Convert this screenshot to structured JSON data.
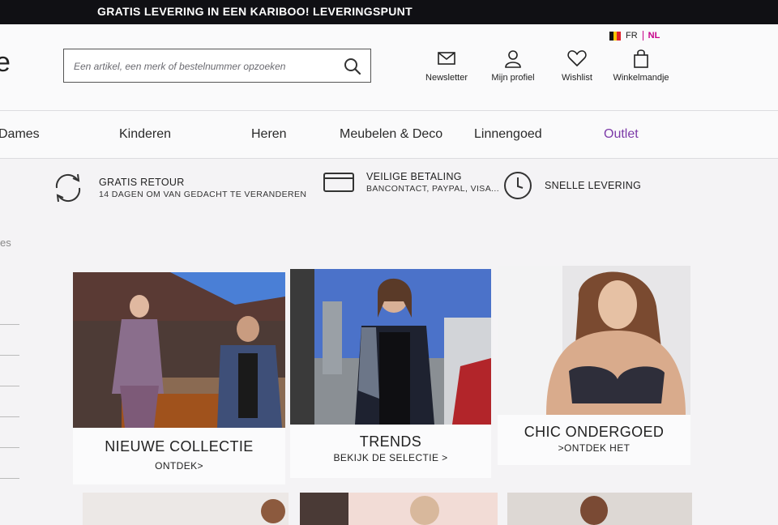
{
  "topbar": {
    "text": "GRATIS LEVERING IN EEN KARIBOO! LEVERINGSPUNT"
  },
  "logo": {
    "fragment": "e"
  },
  "lang": {
    "fr": "FR",
    "nl": "NL"
  },
  "search": {
    "placeholder": "Een artikel, een merk of bestelnummer opzoeken",
    "value": ""
  },
  "header_icons": [
    {
      "label": "Newsletter",
      "icon": "mail-icon"
    },
    {
      "label": "Mijn profiel",
      "icon": "user-icon"
    },
    {
      "label": "Wishlist",
      "icon": "heart-icon"
    },
    {
      "label": "Winkelmandje",
      "icon": "shopping-bag-icon"
    }
  ],
  "nav": {
    "items": [
      "Dames",
      "Kinderen",
      "Heren",
      "Meubelen & Deco",
      "Linnengoed",
      "Outlet"
    ]
  },
  "usps": [
    {
      "title": "GRATIS RETOUR",
      "sub": "14 DAGEN OM VAN GEDACHT TE VERANDEREN",
      "icon": "return-arrows-icon"
    },
    {
      "title": "VEILIGE BETALING",
      "sub": "BANCONTACT, PAYPAL, VISA...",
      "icon": "credit-card-icon"
    },
    {
      "title": "SNELLE LEVERING",
      "sub": "",
      "icon": "clock-icon"
    }
  ],
  "breadcrumb": "es",
  "cards": [
    {
      "title": "NIEUWE COLLECTIE",
      "sub": "ONTDEK>"
    },
    {
      "title": "TRENDS",
      "sub": "BEKIJK DE SELECTIE >"
    },
    {
      "title": "CHIC ONDERGOED",
      "sub": ">ONTDEK HET"
    }
  ],
  "colors": {
    "accent": "#c7008a",
    "outlet": "#7c3aa8",
    "topbar": "#101014"
  }
}
